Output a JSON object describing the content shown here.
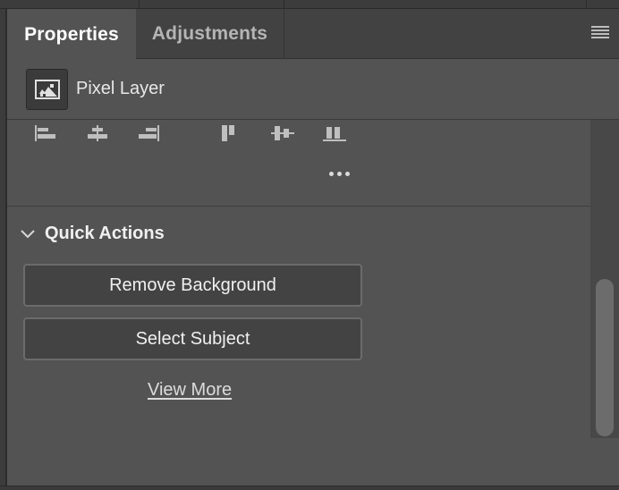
{
  "tabs": {
    "properties": "Properties",
    "adjustments": "Adjustments"
  },
  "layer": {
    "name": "Pixel Layer",
    "icon": "pixel-layer-icon"
  },
  "align": {
    "icons": [
      "align-left-edges-icon",
      "align-horizontal-centers-icon",
      "align-right-edges-icon",
      "align-top-edges-icon",
      "align-vertical-centers-icon",
      "align-bottom-edges-icon"
    ],
    "more_icon": "more-options-icon"
  },
  "quick_actions": {
    "title": "Quick Actions",
    "remove_background": "Remove Background",
    "select_subject": "Select Subject",
    "view_more": "View More"
  },
  "colors": {
    "panel_bg": "#535353",
    "tab_bar_bg": "#424242",
    "button_bg": "#434343",
    "button_border": "#6b6b6b",
    "text": "#f0f0f0"
  }
}
